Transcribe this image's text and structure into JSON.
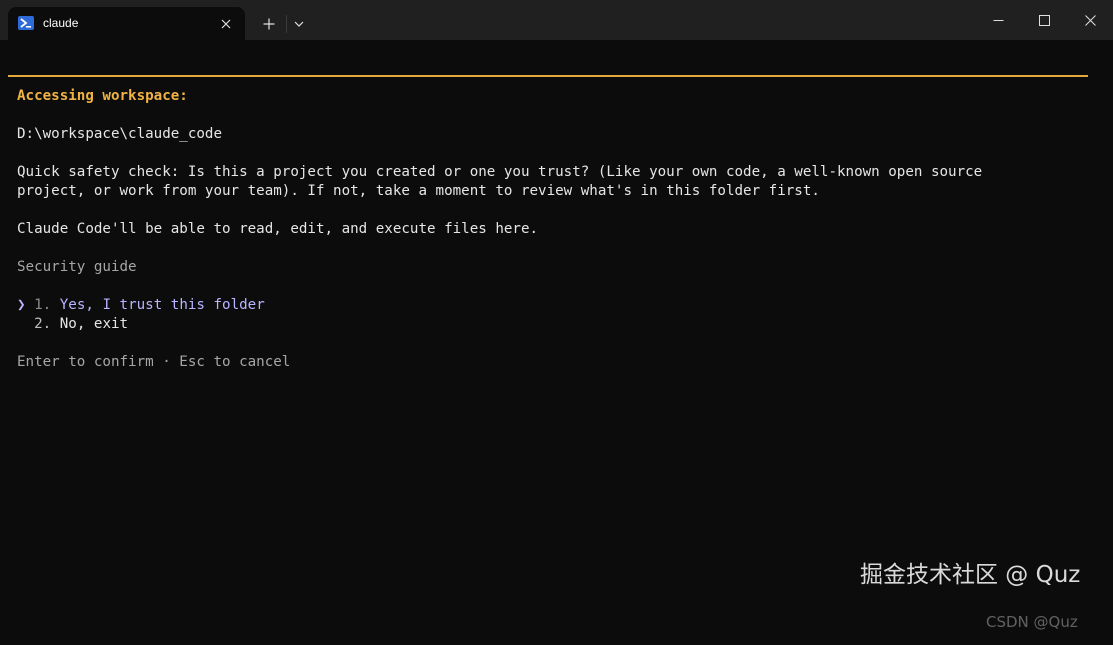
{
  "window": {
    "tab_title": "claude",
    "tab_icon": "powershell-icon",
    "buttons": {
      "new_tab": "plus-icon",
      "dropdown": "chevron-down-icon",
      "minimize": "minimize-icon",
      "maximize": "maximize-icon",
      "close": "close-icon"
    }
  },
  "terminal": {
    "accent_color": "#e3a93c",
    "heading": "Accessing workspace:",
    "path": "D:\\workspace\\claude_code",
    "safety_line1": "Quick safety check: Is this a project you created or one you trust? (Like your own code, a well-known open source",
    "safety_line2": "project, or work from your team). If not, take a moment to review what's in this folder first.",
    "permissions": "Claude Code'll be able to read, edit, and execute files here.",
    "security_guide": "Security guide",
    "options": [
      {
        "pointer": "❯",
        "number": "1.",
        "label": "Yes, I trust this folder",
        "selected": true
      },
      {
        "pointer": "",
        "number": "2.",
        "label": "No, exit",
        "selected": false
      }
    ],
    "hint": "Enter to confirm · Esc to cancel"
  },
  "watermark": {
    "main": "掘金技术社区 @ Quz",
    "secondary": "CSDN @Quz"
  }
}
